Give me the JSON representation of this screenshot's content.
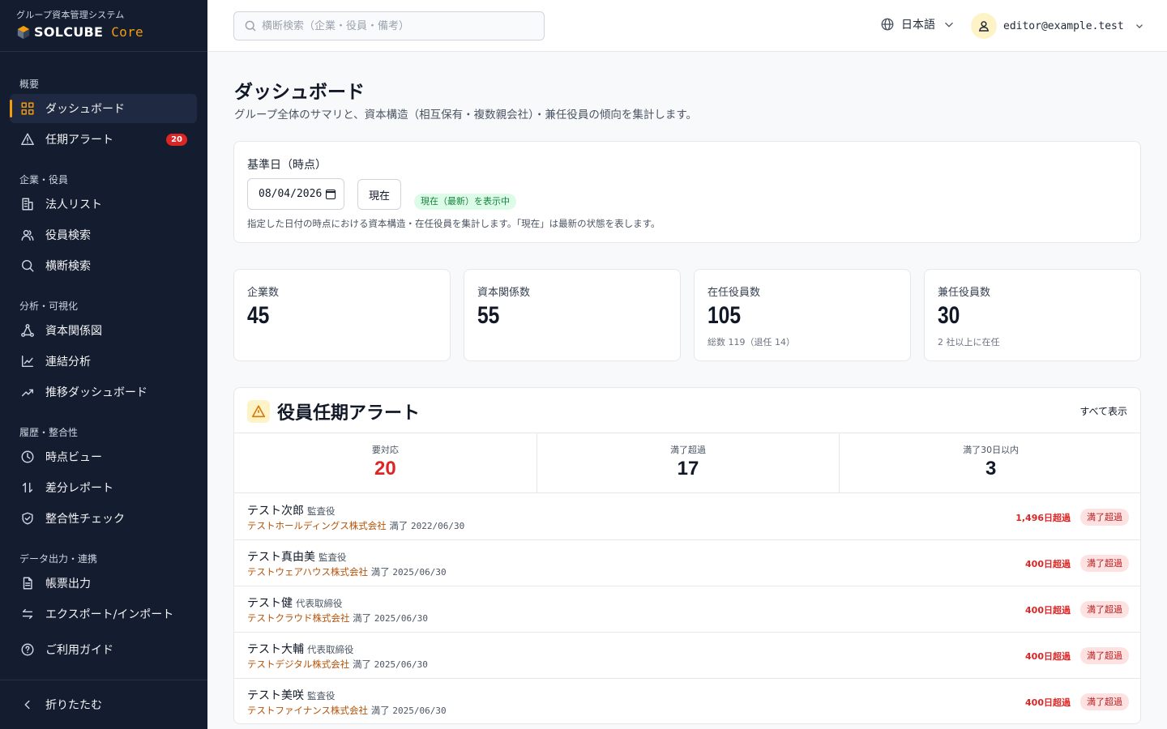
{
  "brand": {
    "subtitle": "グループ資本管理システム",
    "name_main": "SOLCUBE",
    "name_suffix": " Core"
  },
  "sidebar": {
    "sections": [
      {
        "label": "概要"
      },
      {
        "label": "企業・役員"
      },
      {
        "label": "分析・可視化"
      },
      {
        "label": "履歴・整合性"
      },
      {
        "label": "データ出力・連携"
      }
    ],
    "items": [
      {
        "label": "ダッシュボード",
        "icon": "grid-icon",
        "active": true
      },
      {
        "label": "任期アラート",
        "icon": "warning-icon",
        "badge": "20"
      },
      {
        "label": "法人リスト",
        "icon": "building-icon"
      },
      {
        "label": "役員検索",
        "icon": "users-icon"
      },
      {
        "label": "横断検索",
        "icon": "search-icon"
      },
      {
        "label": "資本関係図",
        "icon": "network-icon"
      },
      {
        "label": "連結分析",
        "icon": "chart-line-icon"
      },
      {
        "label": "推移ダッシュボード",
        "icon": "trend-icon"
      },
      {
        "label": "時点ビュー",
        "icon": "clock-icon"
      },
      {
        "label": "差分レポート",
        "icon": "arrows-updown-icon"
      },
      {
        "label": "整合性チェック",
        "icon": "shield-check-icon"
      },
      {
        "label": "帳票出力",
        "icon": "document-icon"
      },
      {
        "label": "エクスポート/インポート",
        "icon": "arrows-leftright-icon"
      },
      {
        "label": "ご利用ガイド",
        "icon": "help-icon"
      }
    ],
    "collapse_label": "折りたたむ"
  },
  "header": {
    "search_placeholder": "横断検索（企業・役員・備考）",
    "language": "日本語",
    "user_email": "editor@example.test"
  },
  "page": {
    "title": "ダッシュボード",
    "subtitle": "グループ全体のサマリと、資本構造（相互保有・複数親会社）・兼任役員の傾向を集計します。"
  },
  "date_filter": {
    "label": "基準日（時点）",
    "value": "08/04/2026",
    "now_button": "現在",
    "status_badge": "現在（最新）を表示中",
    "note": "指定した日付の時点における資本構造・在任役員を集計します。「現在」は最新の状態を表します。"
  },
  "stats": [
    {
      "label": "企業数",
      "value": "45",
      "sub": ""
    },
    {
      "label": "資本関係数",
      "value": "55",
      "sub": ""
    },
    {
      "label": "在任役員数",
      "value": "105",
      "sub": "総数 119（退任 14）"
    },
    {
      "label": "兼任役員数",
      "value": "30",
      "sub": "2 社以上に在任"
    }
  ],
  "alerts": {
    "title": "役員任期アラート",
    "show_all": "すべて表示",
    "summary": [
      {
        "label": "要対応",
        "value": "20",
        "highlight": true
      },
      {
        "label": "満了超過",
        "value": "17"
      },
      {
        "label": "満了30日以内",
        "value": "3"
      }
    ],
    "rows": [
      {
        "name": "テスト次郎",
        "role": "監査役",
        "company": "テストホールディングス株式会社",
        "expiry_label": "満了",
        "expiry_date": "2022/06/30",
        "overdue": "1,496日超過",
        "status": "満了超過"
      },
      {
        "name": "テスト真由美",
        "role": "監査役",
        "company": "テストウェアハウス株式会社",
        "expiry_label": "満了",
        "expiry_date": "2025/06/30",
        "overdue": "400日超過",
        "status": "満了超過"
      },
      {
        "name": "テスト健",
        "role": "代表取締役",
        "company": "テストクラウド株式会社",
        "expiry_label": "満了",
        "expiry_date": "2025/06/30",
        "overdue": "400日超過",
        "status": "満了超過"
      },
      {
        "name": "テスト大輔",
        "role": "代表取締役",
        "company": "テストデジタル株式会社",
        "expiry_label": "満了",
        "expiry_date": "2025/06/30",
        "overdue": "400日超過",
        "status": "満了超過"
      },
      {
        "name": "テスト美咲",
        "role": "監査役",
        "company": "テストファイナンス株式会社",
        "expiry_label": "満了",
        "expiry_date": "2025/06/30",
        "overdue": "400日超過",
        "status": "満了超過"
      }
    ]
  },
  "colors": {
    "sidebar_bg": "#141c2f",
    "accent": "#f59e0b",
    "danger": "#dc2626",
    "company_link": "#b45309",
    "success_bg": "#dcfce7"
  }
}
